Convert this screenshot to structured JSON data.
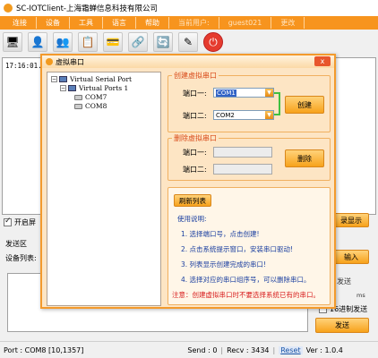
{
  "window": {
    "title": "SC-IOTClient-上海霜蝉信息科技有限公司"
  },
  "menu": {
    "items": [
      "连接",
      "设备",
      "工具",
      "语言",
      "帮助"
    ],
    "current_user_label": "当前用户:",
    "current_user": "guest021",
    "reset_link": "更改"
  },
  "log": {
    "timestamp": "17:16:01.6"
  },
  "main": {
    "open_checkbox_label": "开启屏",
    "show_button": "录显示",
    "send_area_label": "发送区",
    "device_list_label": "设备列表:",
    "input_button": "输入",
    "send_label_partial": "发送",
    "send_unit": "ms",
    "hex_send_label": "16进制发送",
    "send_button": "发送"
  },
  "status": {
    "port_text": "Port : COM8 [10,1357]",
    "send_text": "Send : 0",
    "recv_text": "Recv : 3434",
    "reset_label": "Reset",
    "version_text": "Ver : 1.0.4"
  },
  "dialog": {
    "title": "虚拟串口",
    "close_label": "x",
    "tree": {
      "root": "Virtual Serial Port",
      "child": "Virtual Ports 1",
      "ports": [
        "COM7",
        "COM8"
      ]
    },
    "create_group": {
      "title": "创建虚拟串口",
      "port1_label": "端口一:",
      "port1_value": "COM1",
      "port2_label": "端口二:",
      "port2_value": "COM2",
      "create_button": "创建"
    },
    "delete_group": {
      "title": "删除虚拟串口",
      "port1_label": "端口一:",
      "port2_label": "端口二:",
      "delete_button": "删除"
    },
    "info": {
      "refresh_button": "刷新列表",
      "heading": "使用说明:",
      "steps": [
        "1. 选择端口号，点击创建!",
        "2. 点击系统提示窗口，安装串口驱动!",
        "3. 列表显示创建完成的串口!",
        "4. 选择对应的串口组序号，可以删除串口。"
      ],
      "note": "注意：创建虚拟串口时不要选择系统已有的串口。"
    }
  },
  "colors": {
    "accent": "#f7941e",
    "dialog_bg": "#fde5c4",
    "title_red": "#d94b1a",
    "info_blue": "#1a3fa0",
    "warn_red": "#d81e1e",
    "bracket_green": "#40c040"
  }
}
